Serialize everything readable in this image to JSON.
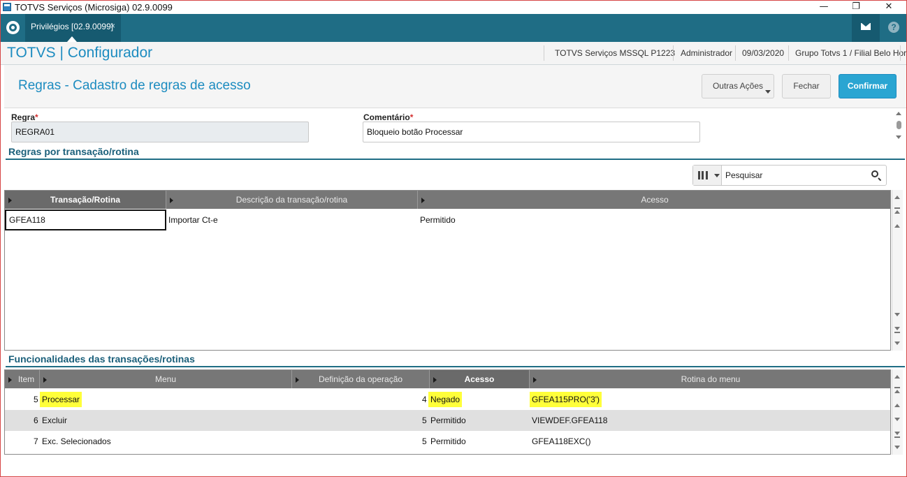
{
  "window": {
    "title": "TOTVS Serviços (Microsiga) 02.9.0099",
    "minimize": "—",
    "restore": "❐",
    "close": "✕"
  },
  "tabbar": {
    "tab_label": "Privilégios [02.9.0099]",
    "tab_close": "×",
    "help": "?"
  },
  "header": {
    "app_title": "TOTVS | Configurador",
    "environment": "TOTVS Serviços MSSQL P1223",
    "user": "Administrador",
    "date": "09/03/2020",
    "branch": "Grupo Totvs 1 / Filial Belo Hor"
  },
  "page": {
    "title": "Regras - Cadastro de regras de acesso",
    "actions": {
      "outras": "Outras Ações",
      "fechar": "Fechar",
      "confirmar": "Confirmar"
    }
  },
  "form": {
    "regra_label": "Regra",
    "regra_value": "REGRA01",
    "comentario_label": "Comentário",
    "comentario_value": "Bloqueio botão Processar",
    "required_mark": "*"
  },
  "section1": {
    "title": "Regras por transação/rotina",
    "search_placeholder": "Pesquisar",
    "columns": [
      "Transação/Rotina",
      "Descrição da transação/rotina",
      "Acesso"
    ],
    "rows": [
      [
        "GFEA118",
        "Importar Ct-e",
        "Permitido"
      ]
    ]
  },
  "section2": {
    "title": "Funcionalidades das transações/rotinas",
    "columns": [
      "Item",
      "Menu",
      "Definição da operação",
      "Acesso",
      "Rotina do menu"
    ],
    "rows": [
      {
        "item": "5",
        "menu": "Processar",
        "definicao": "",
        "acesso_cod": "4",
        "acesso": "Negado",
        "rotina": "GFEA115PRO('3')",
        "highlight": true
      },
      {
        "item": "6",
        "menu": "Excluir",
        "definicao": "",
        "acesso_cod": "5",
        "acesso": "Permitido",
        "rotina": "VIEWDEF.GFEA118",
        "highlight": false
      },
      {
        "item": "7",
        "menu": "Exc. Selecionados",
        "definicao": "",
        "acesso_cod": "5",
        "acesso": "Permitido",
        "rotina": "GFEA118EXC()",
        "highlight": false
      }
    ]
  },
  "colors": {
    "teal": "#1f6d85",
    "title_blue": "#1d8cc0",
    "confirm_button": "#2aa5d2",
    "highlight": "#ffff3a",
    "grid_header": "#777777"
  },
  "icons": [
    "app-icon",
    "totvs-logo-icon",
    "mail-icon",
    "help-icon",
    "columns-icon",
    "chevron-down-icon",
    "search-icon",
    "sort-arrow-icon",
    "scroll-up-icon",
    "scroll-down-icon"
  ]
}
